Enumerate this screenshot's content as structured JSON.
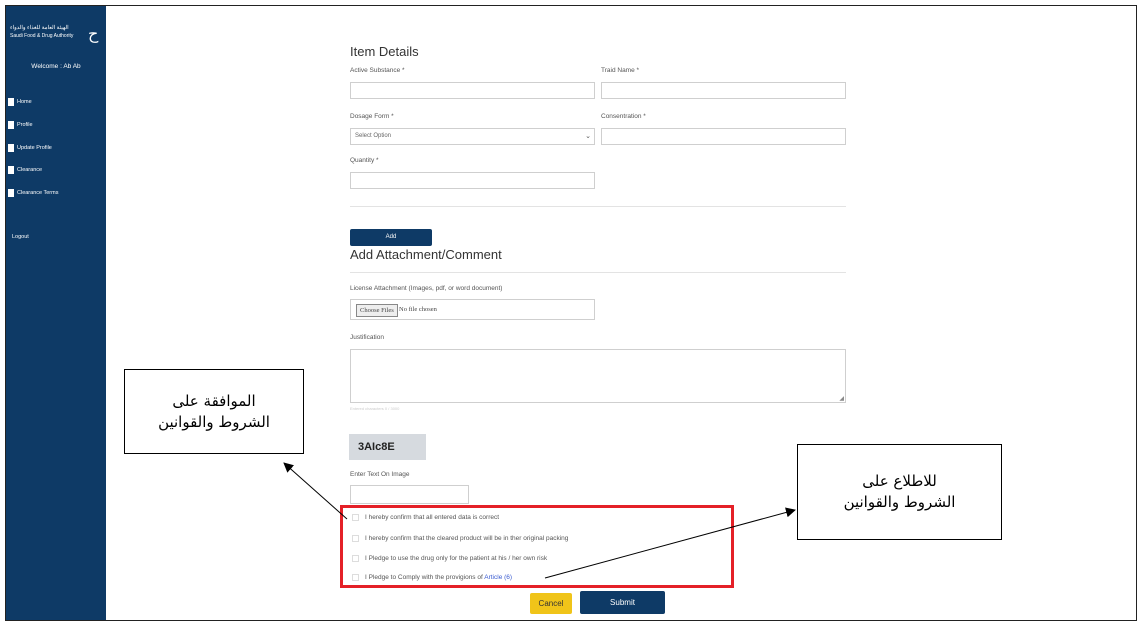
{
  "sidebar": {
    "logo_arabic": "الهيئة العامة للغذاء والدواء",
    "logo_english": "Saudi Food & Drug Authority",
    "welcome": "Welcome : Ab Ab",
    "items": [
      {
        "label": "Home"
      },
      {
        "label": "Profile"
      },
      {
        "label": "Update Profile"
      },
      {
        "label": "Clearance"
      },
      {
        "label": "Clearance Terms"
      }
    ],
    "logout": "Logout"
  },
  "item_details": {
    "title": "Item Details",
    "active_substance_label": "Active Substance *",
    "active_substance_value": "",
    "trade_name_label": "Traid Name *",
    "trade_name_value": "",
    "dosage_form_label": "Dosage Form *",
    "dosage_form_selected": "Select Option",
    "concentration_label": "Consentration *",
    "concentration_value": "",
    "quantity_label": "Quantity *",
    "quantity_value": "",
    "add_button": "Add"
  },
  "attachment": {
    "title": "Add Attachment/Comment",
    "license_label": "License Attachment (Images, pdf, or word document)",
    "choose_files": "Choose Files",
    "no_file": "No file chosen",
    "justification_label": "Justification",
    "justification_value": "",
    "justification_hint": "Entered characters 0 / 3000"
  },
  "captcha": {
    "code": "3AIc8E",
    "label": "Enter Text On Image",
    "value": ""
  },
  "confirmations": [
    {
      "text": "I hereby confirm that all entered data is correct"
    },
    {
      "text": "I hereby confirm that the cleared product will be in ther original packing"
    },
    {
      "text": "I Pledge to use the drug only for the patient at his / her own risk"
    },
    {
      "text": "I Pledge to Comply with the provigions of",
      "link": "Article (6)"
    }
  ],
  "actions": {
    "cancel": "Cancel",
    "submit": "Submit"
  },
  "annotations": {
    "left_line1": "الموافقة على",
    "left_line2": "الشروط والقوانين",
    "right_line1": "للاطلاع على",
    "right_line2": "الشروط والقوانين",
    "highlight_color": "#e42027"
  }
}
